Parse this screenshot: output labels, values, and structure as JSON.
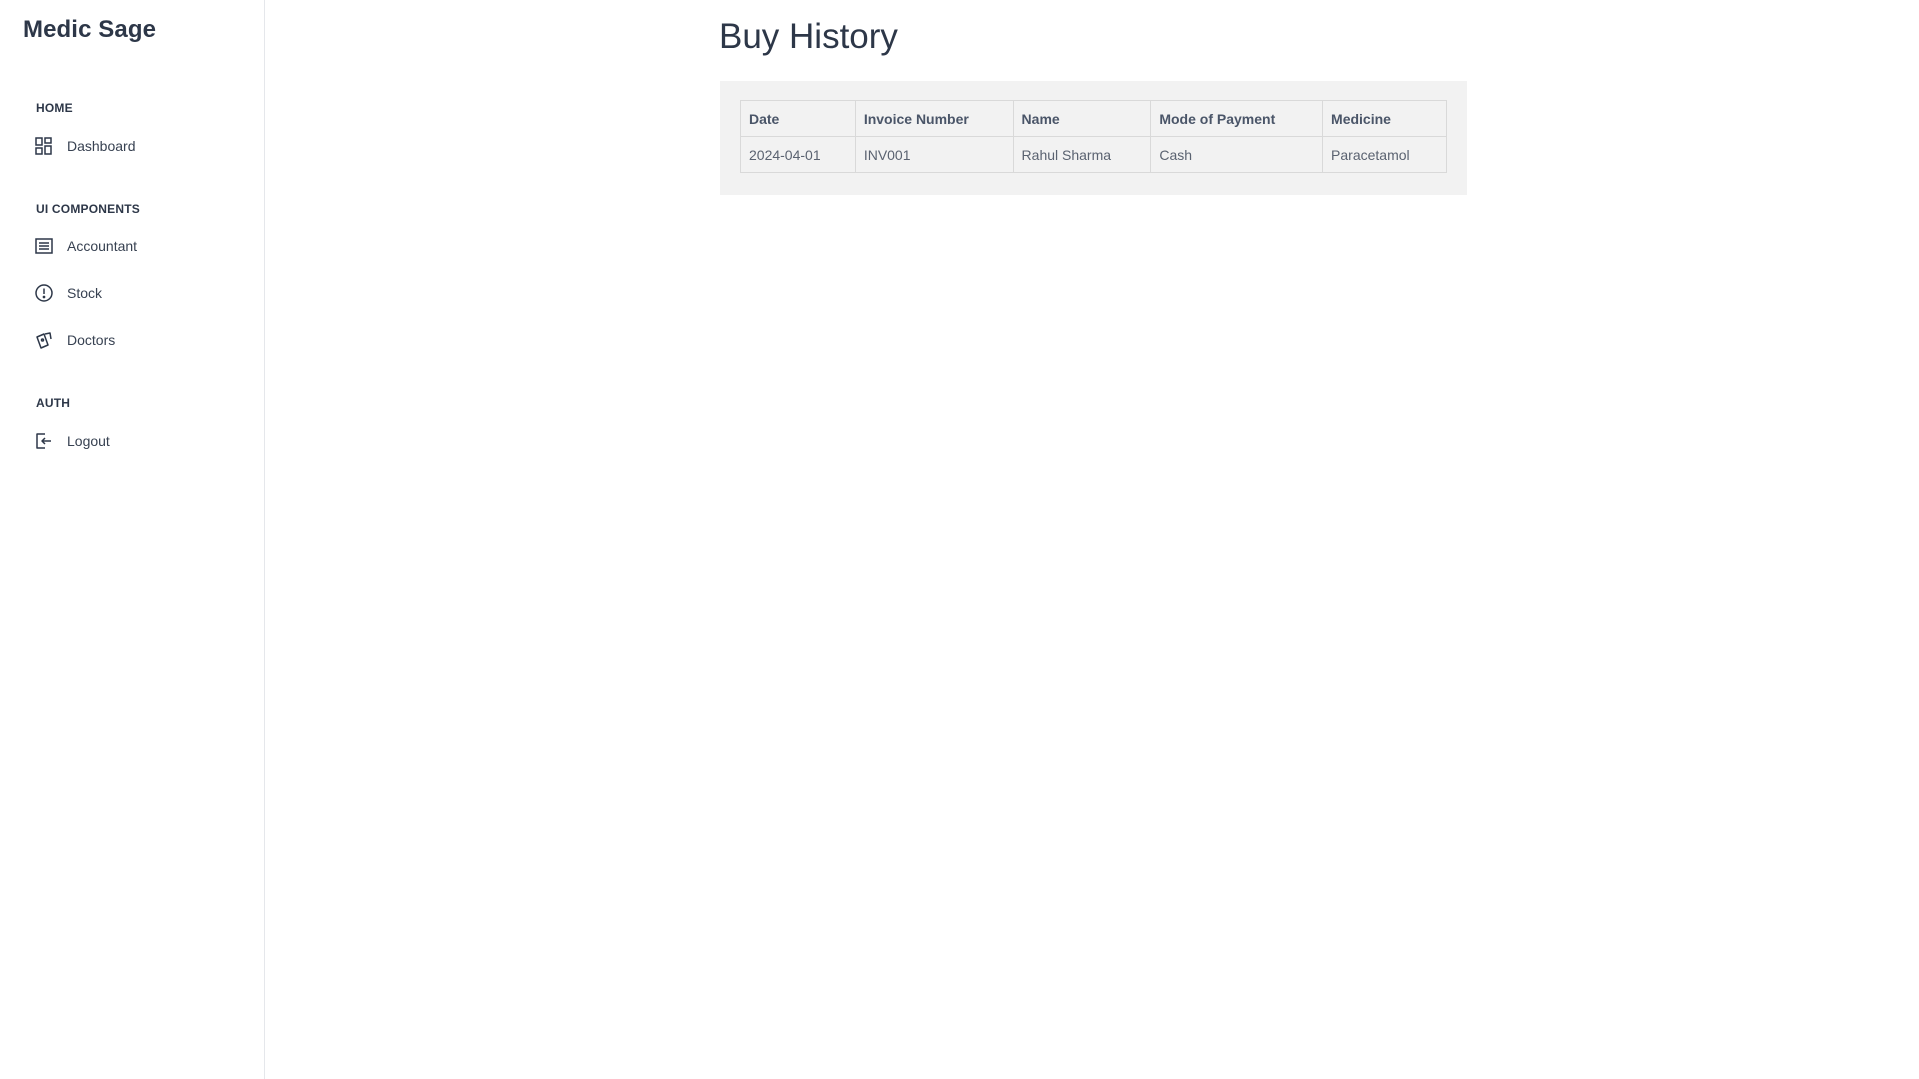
{
  "app": {
    "brand": "Medic Sage"
  },
  "sidebar": {
    "sections": [
      {
        "heading": "HOME",
        "items": [
          {
            "label": "Dashboard",
            "icon": "dashboard-grid-icon"
          }
        ]
      },
      {
        "heading": "UI COMPONENTS",
        "items": [
          {
            "label": "Accountant",
            "icon": "list-box-icon"
          },
          {
            "label": "Stock",
            "icon": "alert-circle-icon"
          },
          {
            "label": "Doctors",
            "icon": "cards-icon"
          }
        ]
      },
      {
        "heading": "AUTH",
        "items": [
          {
            "label": "Logout",
            "icon": "logout-icon"
          }
        ]
      }
    ]
  },
  "main": {
    "title": "Buy History",
    "table": {
      "columns": [
        "Date",
        "Invoice Number",
        "Name",
        "Mode of Payment",
        "Medicine"
      ],
      "rows": [
        [
          "2024-04-01",
          "INV001",
          "Rahul Sharma",
          "Cash",
          "Paracetamol"
        ]
      ]
    }
  },
  "colors": {
    "text": "#2d3748",
    "card_background": "#f2f2f2",
    "border": "#d9d9d9"
  }
}
